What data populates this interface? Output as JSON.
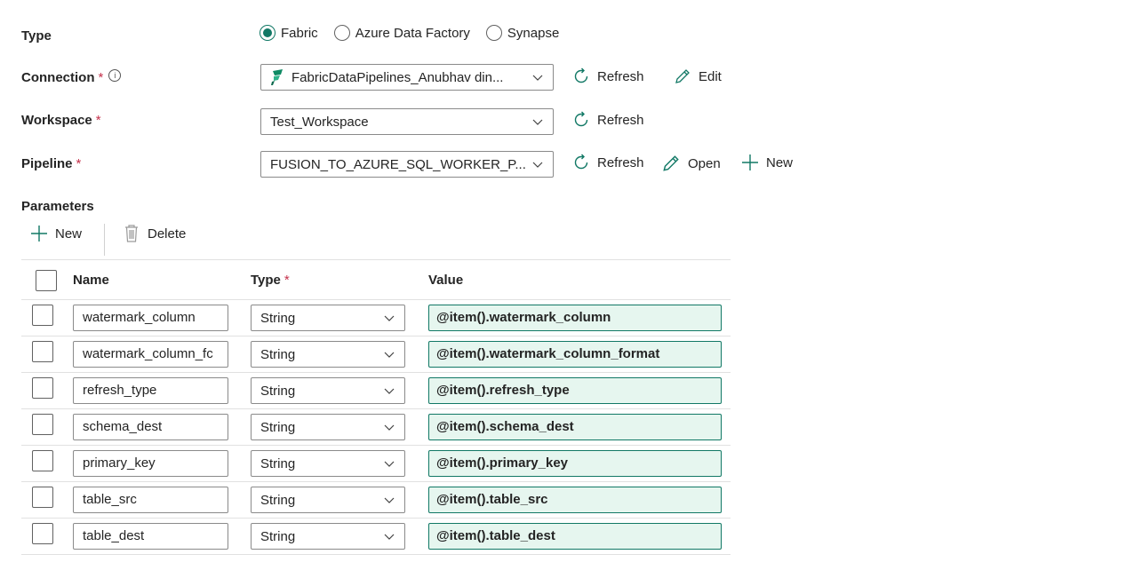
{
  "type_row": {
    "label": "Type",
    "options": [
      "Fabric",
      "Azure Data Factory",
      "Synapse"
    ],
    "selected": "Fabric"
  },
  "connection": {
    "label": "Connection",
    "required": "*",
    "info": "i",
    "value": "FabricDataPipelines_Anubhav din...",
    "refresh": "Refresh",
    "edit": "Edit"
  },
  "workspace": {
    "label": "Workspace",
    "required": "*",
    "value": "Test_Workspace",
    "refresh": "Refresh"
  },
  "pipeline": {
    "label": "Pipeline",
    "required": "*",
    "value": "FUSION_TO_AZURE_SQL_WORKER_P...",
    "refresh": "Refresh",
    "open": "Open",
    "new": "New"
  },
  "parameters": {
    "label": "Parameters",
    "new": "New",
    "delete": "Delete",
    "columns": {
      "name": "Name",
      "type": "Type",
      "type_required": "*",
      "value": "Value"
    },
    "rows": [
      {
        "name": "watermark_column",
        "type": "String",
        "value": "@item().watermark_column"
      },
      {
        "name": "watermark_column_fc",
        "type": "String",
        "value": "@item().watermark_column_format"
      },
      {
        "name": "refresh_type",
        "type": "String",
        "value": "@item().refresh_type"
      },
      {
        "name": "schema_dest",
        "type": "String",
        "value": "@item().schema_dest"
      },
      {
        "name": "primary_key",
        "type": "String",
        "value": "@item().primary_key"
      },
      {
        "name": "table_src",
        "type": "String",
        "value": "@item().table_src"
      },
      {
        "name": "table_dest",
        "type": "String",
        "value": "@item().table_dest"
      }
    ]
  },
  "colors": {
    "accent": "#117865",
    "value_bg": "#e6f6ef"
  }
}
